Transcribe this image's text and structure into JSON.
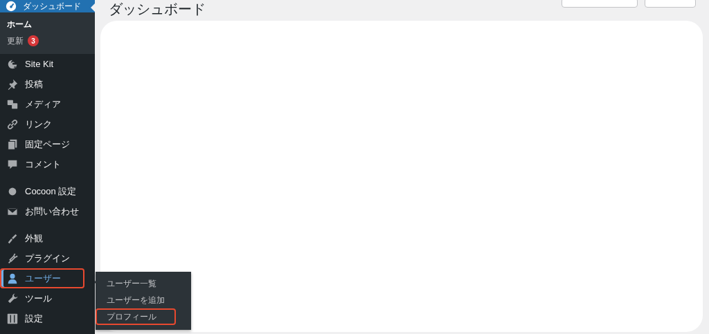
{
  "sidebar": {
    "top_item": {
      "label": "ダッシュボード",
      "selected": true
    },
    "submenu": [
      {
        "label": "ホーム",
        "selected": true
      },
      {
        "label": "更新",
        "badge": "3",
        "selected": false
      }
    ],
    "menu_groups": [
      [
        {
          "label": "Site Kit",
          "selected": false,
          "highlighted": false
        },
        {
          "label": "投稿",
          "selected": false,
          "highlighted": false
        },
        {
          "label": "メディア",
          "selected": false,
          "highlighted": false
        },
        {
          "label": "リンク",
          "selected": false,
          "highlighted": false
        },
        {
          "label": "固定ページ",
          "selected": false,
          "highlighted": false
        },
        {
          "label": "コメント",
          "selected": false,
          "highlighted": false
        }
      ],
      [
        {
          "label": "Cocoon 設定",
          "selected": false,
          "highlighted": false
        },
        {
          "label": "お問い合わせ",
          "selected": false,
          "highlighted": false
        }
      ],
      [
        {
          "label": "外観",
          "selected": false,
          "highlighted": false
        },
        {
          "label": "プラグイン",
          "selected": false,
          "highlighted": false
        },
        {
          "label": "ユーザー",
          "selected": true,
          "highlighted": true
        },
        {
          "label": "ツール",
          "selected": false,
          "highlighted": false
        },
        {
          "label": "設定",
          "selected": false,
          "highlighted": false
        }
      ]
    ]
  },
  "flyout": [
    {
      "label": "ユーザー一覧",
      "highlighted": false
    },
    {
      "label": "ユーザーを追加",
      "highlighted": false
    },
    {
      "label": "プロフィール",
      "highlighted": true
    }
  ],
  "page": {
    "title": "ダッシュボード"
  }
}
